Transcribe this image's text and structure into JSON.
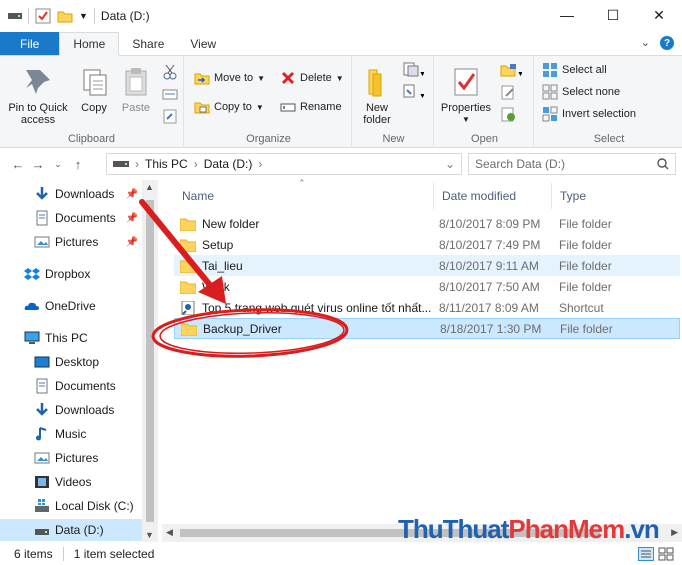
{
  "window": {
    "title": "Data (D:)",
    "min": "—",
    "max": "☐",
    "close": "✕"
  },
  "tabs": [
    {
      "label": "File"
    },
    {
      "label": "Home"
    },
    {
      "label": "Share"
    },
    {
      "label": "View"
    }
  ],
  "ribbon": {
    "clipboard": {
      "label": "Clipboard",
      "pin": "Pin to Quick access",
      "copy": "Copy",
      "paste": "Paste"
    },
    "organize": {
      "label": "Organize",
      "move_to": "Move to",
      "copy_to": "Copy to",
      "delete": "Delete",
      "rename": "Rename"
    },
    "new": {
      "label": "New",
      "new_folder": "New folder"
    },
    "open": {
      "label": "Open",
      "properties": "Properties"
    },
    "select": {
      "label": "Select",
      "select_all": "Select all",
      "select_none": "Select none",
      "invert": "Invert selection"
    }
  },
  "address": {
    "crumbs": [
      "This PC",
      "Data (D:)"
    ],
    "search_placeholder": "Search Data (D:)"
  },
  "nav": {
    "quick": [
      {
        "label": "Downloads",
        "icon": "download-icon"
      },
      {
        "label": "Documents",
        "icon": "documents-icon"
      },
      {
        "label": "Pictures",
        "icon": "pictures-icon"
      }
    ],
    "dropbox": "Dropbox",
    "onedrive": "OneDrive",
    "thispc": "This PC",
    "pc_items": [
      {
        "label": "Desktop",
        "icon": "desktop-icon"
      },
      {
        "label": "Documents",
        "icon": "documents-icon"
      },
      {
        "label": "Downloads",
        "icon": "download-icon"
      },
      {
        "label": "Music",
        "icon": "music-icon"
      },
      {
        "label": "Pictures",
        "icon": "pictures-icon"
      },
      {
        "label": "Videos",
        "icon": "videos-icon"
      },
      {
        "label": "Local Disk (C:)",
        "icon": "drive-icon"
      },
      {
        "label": "Data (D:)",
        "icon": "drive-icon"
      }
    ]
  },
  "columns": {
    "name": "Name",
    "date": "Date modified",
    "type": "Type"
  },
  "files": [
    {
      "name": "New folder",
      "date": "8/10/2017 8:09 PM",
      "type": "File folder"
    },
    {
      "name": "Setup",
      "date": "8/10/2017 7:49 PM",
      "type": "File folder"
    },
    {
      "name": "Tai_lieu",
      "date": "8/10/2017 9:11 AM",
      "type": "File folder"
    },
    {
      "name": "Work",
      "date": "8/10/2017 7:50 AM",
      "type": "File folder"
    },
    {
      "name": "Top 5 trang web quét virus online tốt nhất...",
      "date": "8/11/2017 8:09 AM",
      "type": "Shortcut"
    },
    {
      "name": "Backup_Driver",
      "date": "8/18/2017 1:30 PM",
      "type": "File folder"
    }
  ],
  "status": {
    "items": "6 items",
    "selected": "1 item selected"
  },
  "watermark": {
    "part1": "ThuThuat",
    "part2": "PhanMem",
    "part3": ".vn"
  }
}
